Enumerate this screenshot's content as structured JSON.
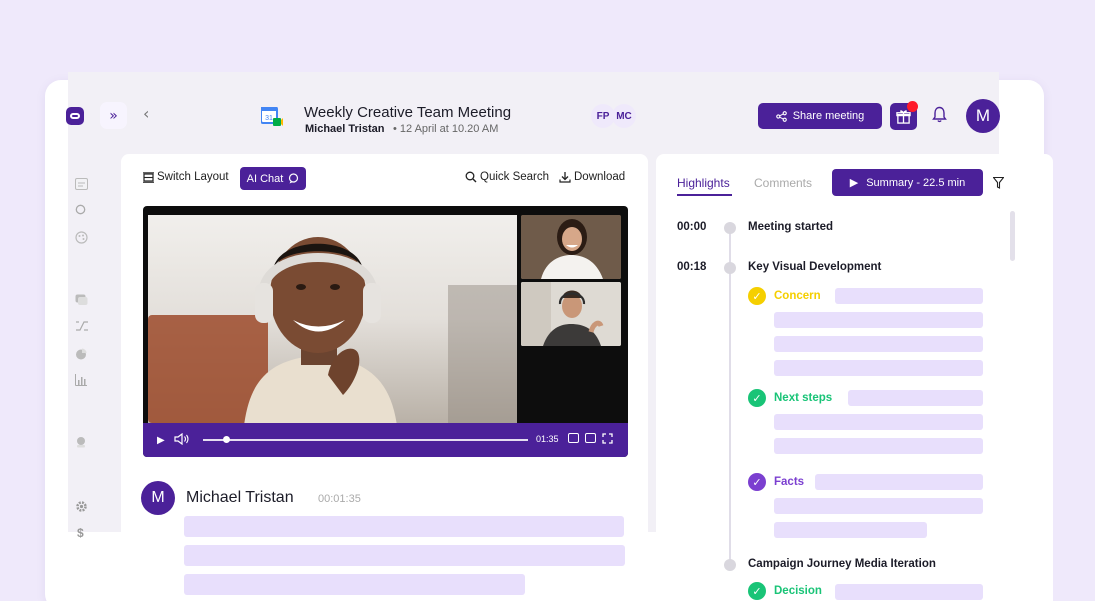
{
  "meeting": {
    "title": "Weekly Creative Team Meeting",
    "owner": "Michael Tristan",
    "date": "• 12 April at 10.20 AM",
    "calendar_day": "31"
  },
  "participants": [
    "FP",
    "MC"
  ],
  "header": {
    "share_label": "Share meeting",
    "user_initial": "M"
  },
  "toolbar": {
    "switch_layout": "Switch Layout",
    "ai_chat": "AI Chat",
    "quick_search": "Quick Search",
    "download": "Download"
  },
  "player": {
    "time": "01:35",
    "progress_fraction": 0.07
  },
  "transcript": {
    "speaker_initial": "M",
    "speaker": "Michael Tristan",
    "timestamp": "00:01:35"
  },
  "right_panel": {
    "tabs": [
      "Highlights",
      "Comments"
    ],
    "summary_label": "Summary - 22.5 min"
  },
  "timeline": [
    {
      "time": "00:00",
      "title": "Meeting started"
    },
    {
      "time": "00:18",
      "title": "Key Visual Development"
    },
    {
      "time": "",
      "title": "Campaign Journey Media Iteration"
    }
  ],
  "categories": [
    {
      "label": "Concern",
      "color": "#f5cf00"
    },
    {
      "label": "Next steps",
      "color": "#19c477"
    },
    {
      "label": "Facts",
      "color": "#7b3fd0"
    },
    {
      "label": "Decision",
      "color": "#19c477"
    }
  ],
  "sidebar_icons": [
    "notes-icon",
    "search-icon",
    "palette-icon",
    "chat-icon",
    "shuffle-icon",
    "chart-pie-icon",
    "bar-chart-icon",
    "user-icon",
    "settings-icon",
    "dollar-icon"
  ],
  "colors": {
    "brand": "#4b2199",
    "placeholder": "#e8dffc",
    "background": "#efe9fb"
  }
}
